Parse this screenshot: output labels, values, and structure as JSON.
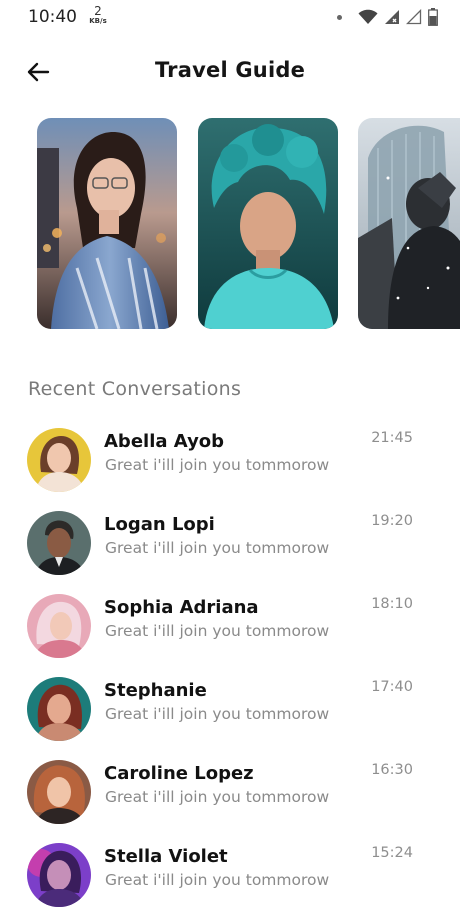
{
  "status_bar": {
    "time": "10:40",
    "net_speed_value": "2",
    "net_speed_unit": "KB/s",
    "icons": [
      "notification-dot-icon",
      "wifi-icon",
      "signal-icon",
      "signal-empty-icon",
      "battery-icon"
    ]
  },
  "header": {
    "title": "Travel Guide",
    "back_icon": "arrow-left-icon"
  },
  "stories": [
    {
      "name": "story-woman-glasses",
      "theme": "city-dusk"
    },
    {
      "name": "story-man-teal-hair",
      "theme": "teal"
    },
    {
      "name": "story-man-snow",
      "theme": "snow"
    }
  ],
  "section": {
    "title": "Recent Conversations"
  },
  "conversations": [
    {
      "name": "Abella Ayob",
      "message": "Great i'ill join you tommorow",
      "time": "21:45",
      "avatar_color": "#e7c63a"
    },
    {
      "name": "Logan Lopi",
      "message": "Great i'ill join you tommorow",
      "time": "19:20",
      "avatar_color": "#5a6f6d"
    },
    {
      "name": "Sophia Adriana",
      "message": "Great i'ill join you tommorow",
      "time": "18:10",
      "avatar_color": "#e8a9b8"
    },
    {
      "name": "Stephanie",
      "message": "Great i'ill join you tommorow",
      "time": "17:40",
      "avatar_color": "#1d7c7a"
    },
    {
      "name": "Caroline Lopez",
      "message": "Great i'ill join you tommorow",
      "time": "16:30",
      "avatar_color": "#8a5a45"
    },
    {
      "name": "Stella Violet",
      "message": "Great i'ill join you tommorow",
      "time": "15:24",
      "avatar_color": "#7c3fc9"
    }
  ],
  "colors": {
    "title": "#151515",
    "section_title": "#7a7a7a",
    "secondary_text": "#8a8a8a",
    "background": "#ffffff"
  }
}
